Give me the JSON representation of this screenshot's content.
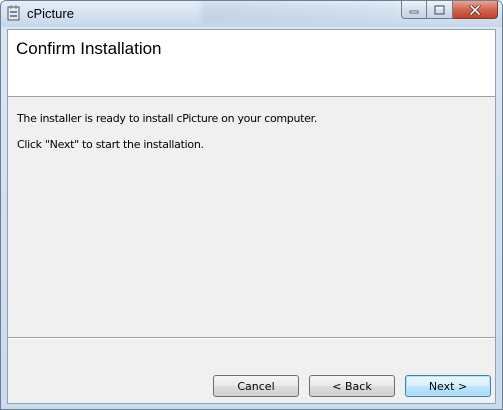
{
  "window": {
    "title": "cPicture",
    "caption_buttons": [
      "minimize-icon",
      "maximize-icon",
      "close-icon"
    ]
  },
  "banner": {
    "title": "Confirm Installation"
  },
  "body": {
    "line1": "The installer is ready to install cPicture on your computer.",
    "line2": "Click \"Next\" to start the installation."
  },
  "buttons": {
    "cancel": "Cancel",
    "back": "< Back",
    "next": "Next >"
  },
  "colors": {
    "close_button": "#c8432a",
    "default_button_border": "#3c7fb1"
  }
}
